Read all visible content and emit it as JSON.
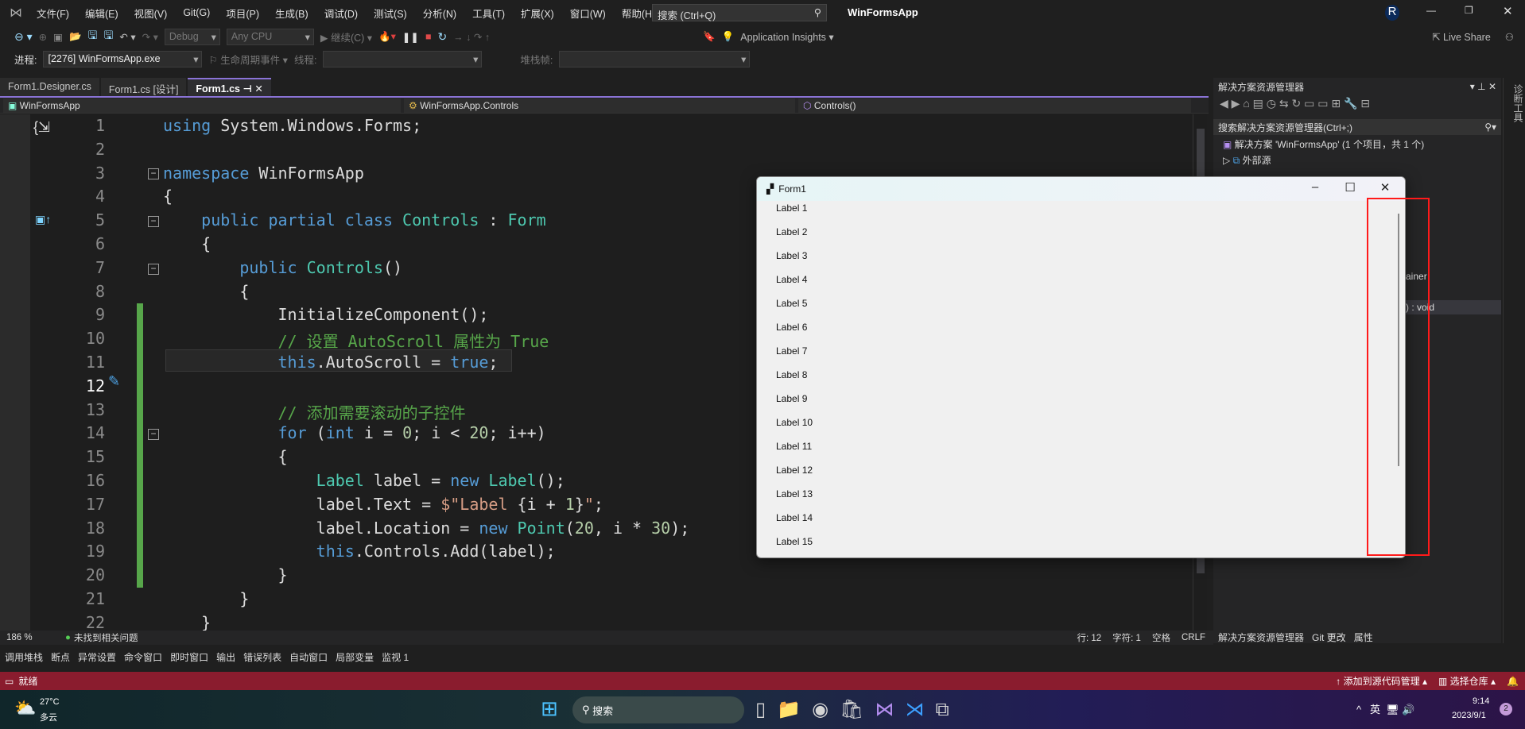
{
  "titlebar": {
    "app_title": "WinFormsApp",
    "search_placeholder": "搜索 (Ctrl+Q)",
    "avatar": "R",
    "menu": [
      "文件(F)",
      "编辑(E)",
      "视图(V)",
      "Git(G)",
      "项目(P)",
      "生成(B)",
      "调试(D)",
      "测试(S)",
      "分析(N)",
      "工具(T)",
      "扩展(X)",
      "窗口(W)",
      "帮助(H)"
    ]
  },
  "toolbar": {
    "config": "Debug",
    "platform": "Any CPU",
    "continue": "继续(C)",
    "app_insights": "Application Insights",
    "live_share": "Live Share"
  },
  "toolbar2": {
    "process_label": "进程:",
    "process_value": "[2276] WinFormsApp.exe",
    "lifecycle": "生命周期事件",
    "thread_label": "线程:",
    "stack_label": "堆栈帧:"
  },
  "tabs": [
    {
      "label": "Form1.Designer.cs"
    },
    {
      "label": "Form1.cs [设计]"
    },
    {
      "label": "Form1.cs",
      "active": true
    }
  ],
  "navbar": {
    "project": "WinFormsApp",
    "class": "WinFormsApp.Controls",
    "member": "Controls()"
  },
  "editor": {
    "current_line": 12,
    "lines": [
      [
        [
          "k",
          "using"
        ],
        [
          "p",
          " System.Windows.Forms;"
        ]
      ],
      [],
      [
        [
          "k",
          "namespace"
        ],
        [
          "p",
          " WinFormsApp"
        ]
      ],
      [
        [
          "p",
          "{"
        ]
      ],
      [
        [
          "p",
          "    "
        ],
        [
          "k",
          "public partial class"
        ],
        [
          "p",
          " "
        ],
        [
          "t",
          "Controls"
        ],
        [
          "p",
          " : "
        ],
        [
          "t",
          "Form"
        ]
      ],
      [
        [
          "p",
          "    {"
        ]
      ],
      [
        [
          "p",
          "        "
        ],
        [
          "k",
          "public"
        ],
        [
          "p",
          " "
        ],
        [
          "t",
          "Controls"
        ],
        [
          "p",
          "()"
        ]
      ],
      [
        [
          "p",
          "        {"
        ]
      ],
      [
        [
          "p",
          "            InitializeComponent();"
        ]
      ],
      [
        [
          "p",
          "            "
        ],
        [
          "c",
          "// 设置 AutoScroll 属性为 True"
        ]
      ],
      [
        [
          "p",
          "            "
        ],
        [
          "k",
          "this"
        ],
        [
          "p",
          ".AutoScroll = "
        ],
        [
          "k",
          "true"
        ],
        [
          "p",
          ";"
        ]
      ],
      [],
      [
        [
          "p",
          "            "
        ],
        [
          "c",
          "// 添加需要滚动的子控件"
        ]
      ],
      [
        [
          "p",
          "            "
        ],
        [
          "k",
          "for"
        ],
        [
          "p",
          " ("
        ],
        [
          "k",
          "int"
        ],
        [
          "p",
          " i = "
        ],
        [
          "n",
          "0"
        ],
        [
          "p",
          "; i < "
        ],
        [
          "n",
          "20"
        ],
        [
          "p",
          "; i++)"
        ]
      ],
      [
        [
          "p",
          "            {"
        ]
      ],
      [
        [
          "p",
          "                "
        ],
        [
          "t",
          "Label"
        ],
        [
          "p",
          " label = "
        ],
        [
          "k",
          "new"
        ],
        [
          "p",
          " "
        ],
        [
          "t",
          "Label"
        ],
        [
          "p",
          "();"
        ]
      ],
      [
        [
          "p",
          "                label.Text = "
        ],
        [
          "s",
          "$\"Label "
        ],
        [
          "p",
          "{i + "
        ],
        [
          "n",
          "1"
        ],
        [
          "p",
          "}"
        ],
        [
          "s",
          "\""
        ],
        [
          "p",
          ";"
        ]
      ],
      [
        [
          "p",
          "                label.Location = "
        ],
        [
          "k",
          "new"
        ],
        [
          "p",
          " "
        ],
        [
          "t",
          "Point"
        ],
        [
          "p",
          "("
        ],
        [
          "n",
          "20"
        ],
        [
          "p",
          ", i * "
        ],
        [
          "n",
          "30"
        ],
        [
          "p",
          ");"
        ]
      ],
      [
        [
          "p",
          "                "
        ],
        [
          "k",
          "this"
        ],
        [
          "p",
          ".Controls.Add(label);"
        ]
      ],
      [
        [
          "p",
          "            }"
        ]
      ],
      [
        [
          "p",
          "        }"
        ]
      ],
      [
        [
          "p",
          "    }"
        ]
      ]
    ]
  },
  "editor_status": {
    "zoom": "186 %",
    "issues": "未找到相关问题",
    "line": "行: 12",
    "char": "字符: 1",
    "spaces": "空格",
    "eol": "CRLF"
  },
  "bottom_tabs": [
    "调用堆栈",
    "断点",
    "异常设置",
    "命令窗口",
    "即时窗口",
    "输出",
    "错误列表",
    "自动窗口",
    "局部变量",
    "监视 1"
  ],
  "statusbar": {
    "ready": "就绪",
    "add_source": "添加到源代码管理",
    "select_repo": "选择仓库"
  },
  "solution_explorer": {
    "title": "解决方案资源管理器",
    "search_placeholder": "搜索解决方案资源管理器(Ctrl+;)",
    "solution": "解决方案 'WinFormsApp' (1 个项目，共 1 个)",
    "external": "外部源",
    "partial1": "ainer",
    "partial2": ") : void",
    "tabs": [
      "解决方案资源管理器",
      "Git 更改",
      "属性"
    ],
    "side_strip": "诊断工具"
  },
  "form1": {
    "title": "Form1",
    "labels": [
      "Label 1",
      "Label 2",
      "Label 3",
      "Label 4",
      "Label 5",
      "Label 6",
      "Label 7",
      "Label 8",
      "Label 9",
      "Label 10",
      "Label 11",
      "Label 12",
      "Label 13",
      "Label 14",
      "Label 15"
    ]
  },
  "taskbar": {
    "temp": "27°C",
    "weather": "多云",
    "search": "搜索",
    "ime": "英",
    "time": "9:14",
    "date": "2023/9/1",
    "badge": "2"
  },
  "colors": {
    "accent": "#8a73d6",
    "statusbar": "#8a1c2e",
    "highlight_box": "#ff1a1a",
    "change_bar": "#57a64a"
  }
}
